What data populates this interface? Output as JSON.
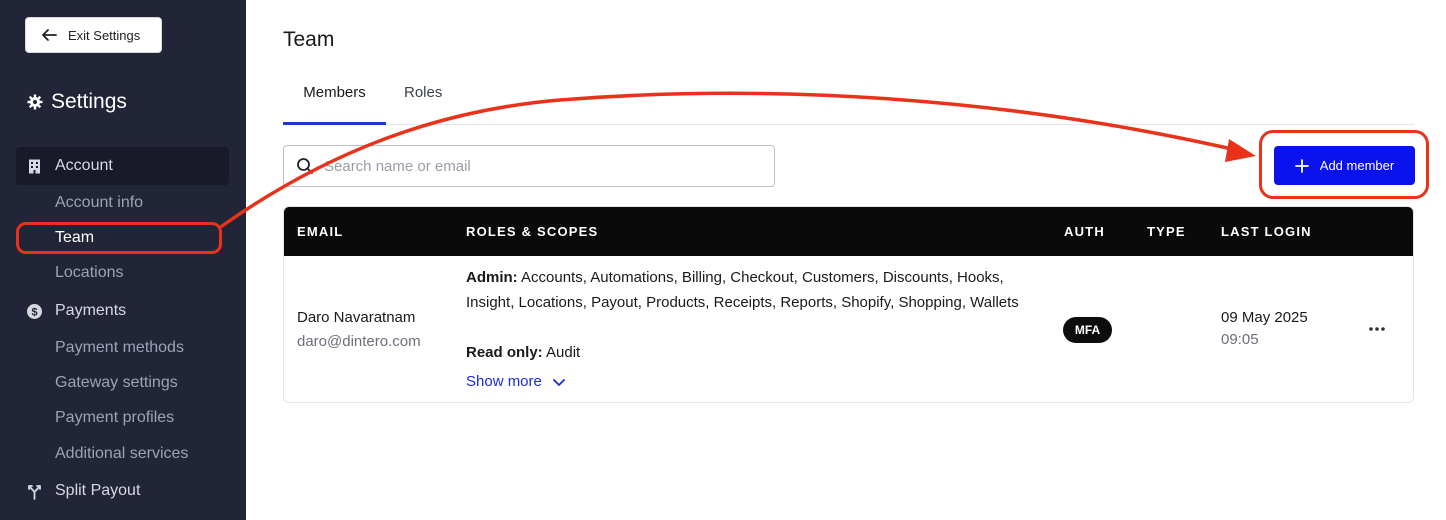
{
  "sidebar": {
    "exit_label": "Exit Settings",
    "title": "Settings",
    "groups": [
      {
        "label": "Account",
        "icon": "building-icon",
        "items": [
          "Account info",
          "Team",
          "Locations"
        ]
      },
      {
        "label": "Payments",
        "icon": "dollar-circle-icon",
        "items": [
          "Payment methods",
          "Gateway settings",
          "Payment profiles",
          "Additional services"
        ]
      },
      {
        "label": "Split Payout",
        "icon": "split-icon",
        "items": []
      }
    ],
    "active_item": "Team"
  },
  "main": {
    "title": "Team",
    "tabs": [
      {
        "label": "Members",
        "active": true
      },
      {
        "label": "Roles",
        "active": false
      }
    ],
    "search": {
      "placeholder": "Search name or email",
      "value": ""
    },
    "add_button": "Add member",
    "table": {
      "headers": [
        "EMAIL",
        "ROLES & SCOPES",
        "AUTH",
        "TYPE",
        "LAST LOGIN"
      ],
      "rows": [
        {
          "name": "Daro Navaratnam",
          "email": "daro@dintero.com",
          "admin_label": "Admin:",
          "admin_scopes": "Accounts, Automations, Billing, Checkout, Customers, Discounts, Hooks, Insight, Locations, Payout, Products, Receipts, Reports, Shopify, Shopping, Wallets",
          "readonly_label": "Read only:",
          "readonly_scopes": "Audit",
          "show_more": "Show more",
          "auth": "MFA",
          "type": "",
          "last_login_date": "09 May 2025",
          "last_login_time": "09:05"
        }
      ]
    }
  },
  "colors": {
    "sidebar_bg": "#222537",
    "accent": "#0a13ee",
    "annotation": "#e8321a",
    "table_header_bg": "#0a0a0a"
  }
}
